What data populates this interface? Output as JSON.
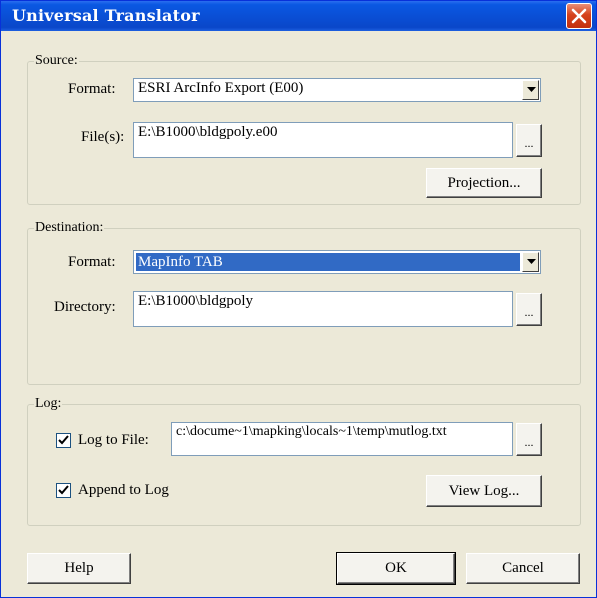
{
  "window": {
    "title": "Universal Translator"
  },
  "source": {
    "legend": "Source:",
    "format_label": "Format:",
    "format_value": "ESRI ArcInfo Export (E00)",
    "files_label": "File(s):",
    "files_value": "E:\\B1000\\bldgpoly.e00",
    "browse_label": "...",
    "projection_label": "Projection..."
  },
  "destination": {
    "legend": "Destination:",
    "format_label": "Format:",
    "format_value": "MapInfo TAB",
    "directory_label": "Directory:",
    "directory_value": "E:\\B1000\\bldgpoly",
    "browse_label": "..."
  },
  "log": {
    "legend": "Log:",
    "log_to_file_label": "Log to File:",
    "log_to_file_checked": true,
    "log_path": "c:\\docume~1\\mapking\\locals~1\\temp\\mutlog.txt",
    "browse_label": "...",
    "append_label": "Append to Log",
    "append_checked": true,
    "view_log_label": "View Log..."
  },
  "footer": {
    "help_label": "Help",
    "ok_label": "OK",
    "cancel_label": "Cancel"
  },
  "colors": {
    "titlebar": "#0a4fd6",
    "dialog_bg": "#ece9d8",
    "selection": "#316ac5",
    "close_button": "#d6421c"
  },
  "icons": {
    "close": "close-x-icon",
    "dropdown": "chevron-down-icon",
    "checkbox": "check-icon"
  }
}
